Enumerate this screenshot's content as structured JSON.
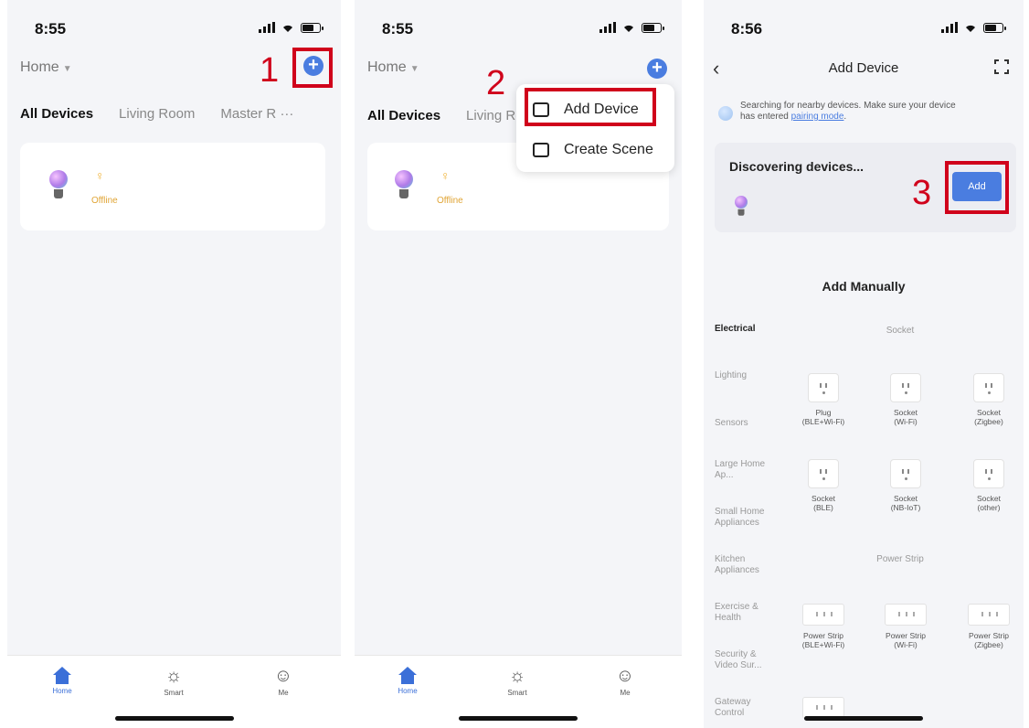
{
  "status": {
    "time_1": "8:55",
    "time_2": "8:55",
    "time_3": "8:56"
  },
  "home": {
    "title": "Home",
    "tabs": [
      "All Devices",
      "Living Room",
      "Master R"
    ],
    "more": "···",
    "device_status": "Offline"
  },
  "tabbar": {
    "home": "Home",
    "smart": "Smart",
    "me": "Me"
  },
  "menu": {
    "add_device": "Add Device",
    "create_scene": "Create Scene"
  },
  "steps": [
    "1",
    "2",
    "3"
  ],
  "add_device": {
    "title": "Add Device",
    "search_text_1": "Searching for nearby devices. Make sure your device",
    "search_text_2": "has entered",
    "search_link": "pairing mode",
    "search_end": ".",
    "discovering": "Discovering devices...",
    "add_button": "Add",
    "manual_title": "Add Manually",
    "categories": [
      "Electrical",
      "Lighting",
      "Sensors",
      "Large Home Ap...",
      "Small Home Appliances",
      "Kitchen Appliances",
      "Exercise & Health",
      "Security & Video Sur...",
      "Gateway Control"
    ],
    "section_socket": "Socket",
    "section_strip": "Power Strip",
    "socket_tiles": [
      [
        "Plug",
        "(BLE+Wi-Fi)"
      ],
      [
        "Socket",
        "(Wi-Fi)"
      ],
      [
        "Socket",
        "(Zigbee)"
      ],
      [
        "Socket",
        "(BLE)"
      ],
      [
        "Socket",
        "(NB-IoT)"
      ],
      [
        "Socket",
        "(other)"
      ]
    ],
    "strip_tiles": [
      [
        "Power Strip",
        "(BLE+Wi-Fi)"
      ],
      [
        "Power Strip",
        "(Wi-Fi)"
      ],
      [
        "Power Strip",
        "(Zigbee)"
      ]
    ]
  }
}
